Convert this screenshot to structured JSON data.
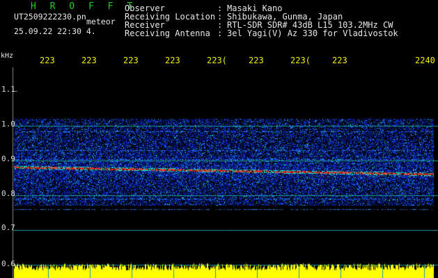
{
  "header": {
    "brand": "H R O F F T",
    "filename": "UT2509222230.pn",
    "tag": "meteor",
    "datetime": "25.09.22 22:30   4.",
    "labels": [
      "Observer",
      "Receiving Location",
      "Receiver",
      "Receiving Antenna"
    ],
    "colons": [
      ":",
      ":",
      ":",
      ":"
    ],
    "values": [
      "Masaki Kano",
      "Shibukawa, Gunma, Japan",
      "RTL-SDR SDR# 43dB L15 103.2MHz CW",
      "3el Yagi(V) Az 330 for Vladivostok"
    ]
  },
  "chart_data": {
    "type": "heatmap",
    "ylabel": "kHz",
    "x_tick_labels": [
      "223",
      "223",
      "223",
      "223",
      "223(",
      "223",
      "223(",
      "223",
      "2240"
    ],
    "y_tick_labels": [
      "1.1",
      "1.0",
      "0.9",
      "0.8",
      "0.7",
      "0.6"
    ],
    "ylim": [
      0.6,
      1.15
    ],
    "carrier_trace_khz": [
      0.882,
      0.861
    ],
    "noise_band_khz": [
      0.77,
      1.02
    ],
    "colors": {
      "background": "#000000",
      "noise": "#1a3cff",
      "trace": "#ff2020",
      "grid": "#1e9c9c",
      "signal_strength": "#ffff00"
    }
  }
}
